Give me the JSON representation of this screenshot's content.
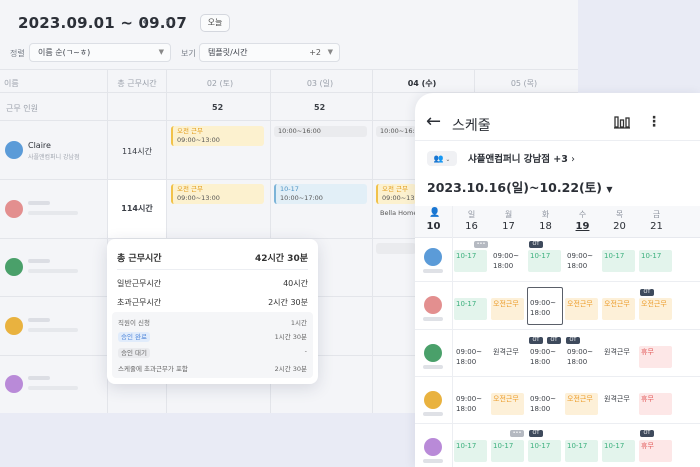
{
  "desktop": {
    "date_range": "2023.09.01 ~ 09.07",
    "prev_icon": "chevron-left-icon",
    "next_icon": "chevron-right-icon",
    "today_label": "오늘",
    "filter_sort_label": "정렬",
    "filter_sort_value": "이름 순(ㄱ~ㅎ)",
    "filter_view_label": "보기",
    "filter_view_value": "템플릿/시간",
    "filter_view_more": "+2",
    "col_name": "이름",
    "col_total": "총 근무시간",
    "days": [
      "02 (토)",
      "03 (일)",
      "04 (수)",
      "05 (목)"
    ],
    "staff_label": "근무 인원",
    "staff_counts": [
      "52",
      "52"
    ],
    "person1_name": "Claire",
    "person1_org": "사플앤컴퍼니 강남점",
    "person1_hours": "114시간",
    "person2_hours": "114시간",
    "shift_morning": "오전 근무",
    "shift_morning_time": "09:00~13:00",
    "shift_mid_time": "10:00~16:00",
    "shift_1017": "10-17",
    "shift_1017_time": "10:00~17:00",
    "shift_bella": "Bella Home"
  },
  "tooltip": {
    "title": "총 근무시간",
    "title_value": "42시간 30분",
    "regular_label": "일반근무시간",
    "regular_value": "40시간",
    "overtime_label": "초과근무시간",
    "overtime_value": "2시간 30분",
    "req_label": "직원이 신청",
    "req_value": "1시간",
    "approved_label": "승인 완료",
    "approved_value": "1시간 30분",
    "pending_label": "승인 대기",
    "pending_value": "-",
    "included_label": "스케줄에 초과근무가 포함",
    "included_value": "2시간 30분"
  },
  "mobile": {
    "back_icon": "arrow-left-icon",
    "title": "스케줄",
    "chart_icon": "bar-chart-icon",
    "more_icon": "more-vertical-icon",
    "group_icon": "people-icon",
    "store": "샤플앤컴퍼니 강남점 +3",
    "week": "2023.10.16(일)~10.22(토)",
    "headcount": "10",
    "day_names": [
      "일",
      "월",
      "화",
      "수",
      "목",
      "금"
    ],
    "day_nums": [
      "16",
      "17",
      "18",
      "19",
      "20",
      "21"
    ],
    "shift_1017": "10-17",
    "shift_0918": "09:00~\n18:00",
    "shift_morning": "오전근무",
    "shift_remote": "원격근무",
    "shift_leave": "휴무",
    "tag_ot": "OT",
    "tag_dots": "•••",
    "colors": {
      "accent": "#3db07e",
      "orange": "#ec9c2a",
      "red": "#e35c5c"
    }
  }
}
